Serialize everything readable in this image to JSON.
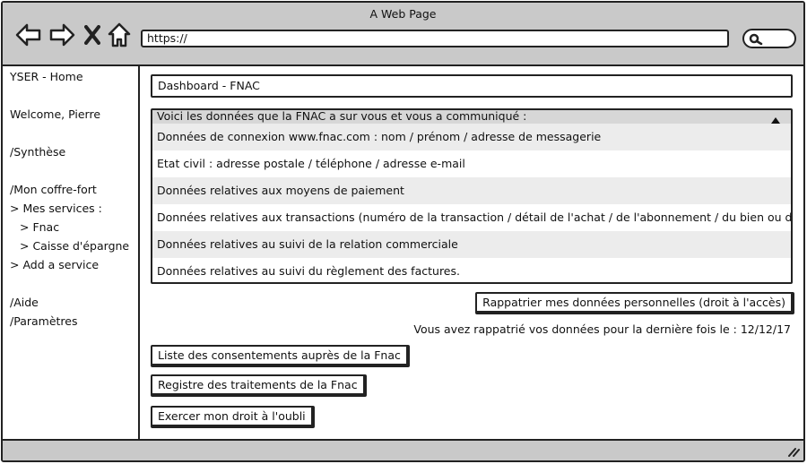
{
  "window": {
    "title": "A Web Page",
    "url": "https://",
    "icons": [
      "back-arrow-icon",
      "forward-arrow-icon",
      "close-icon",
      "home-icon",
      "search-icon",
      "resize-grip-icon"
    ]
  },
  "sidebar": {
    "home": "YSER - Home",
    "welcome": "Welcome, Pierre",
    "synthese": "/Synthèse",
    "coffre": "/Mon coffre-fort",
    "mes_services": "> Mes services :",
    "fnac": "> Fnac",
    "caisse": "> Caisse d'épargne",
    "add_service": "> Add a service",
    "aide": "/Aide",
    "parametres": "/Paramètres"
  },
  "main": {
    "dashboard_title": "Dashboard - FNAC",
    "accordion": {
      "header": "Voici les données que la FNAC a sur vous et vous a communiqué :",
      "rows": [
        "Données de connexion www.fnac.com : nom / prénom / adresse de messagerie",
        "Etat civil : adresse postale / téléphone / adresse e-mail",
        "Données relatives aux moyens de paiement",
        "Données relatives aux transactions (numéro de la transaction / détail de l'achat / de l'abonnement / du bien ou du",
        "Données relatives au suivi de la relation commerciale",
        "Données relatives au suivi du règlement des factures."
      ]
    },
    "repatriate_button": "Rappatrier mes données personnelles (droit à l'accès)",
    "last_repatriation": "Vous avez rappatrié vos données pour la dernière fois le : 12/12/17",
    "consent_button": "Liste des consentements auprès de la Fnac",
    "register_button": "Registre des traitements de la Fnac",
    "forget_button": "Exercer mon droit à l'oubli"
  },
  "colors": {
    "chrome": "#c9c9c9",
    "accordion_header": "#d7d7d7",
    "row_alt": "#ececec",
    "border": "#222222"
  }
}
